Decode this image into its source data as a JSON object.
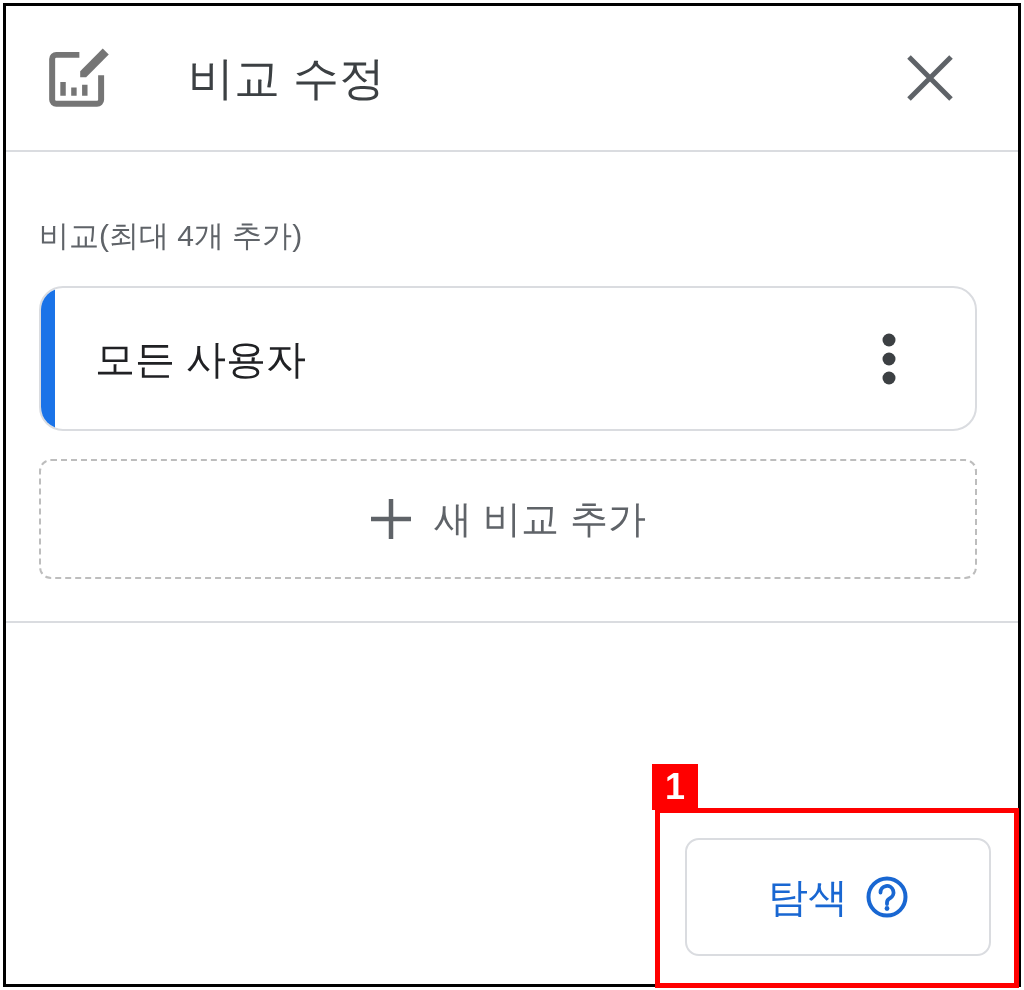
{
  "panel": {
    "title": "비교 수정"
  },
  "comparisons_section": {
    "label": "비교(최대 4개 추가)",
    "items": [
      {
        "name": "모든 사용자",
        "color": "#1a73e8"
      }
    ],
    "add_button": "새 비교 추가"
  },
  "footer": {
    "explore_button": "탐색"
  },
  "annotations": [
    {
      "label": "1"
    }
  ]
}
